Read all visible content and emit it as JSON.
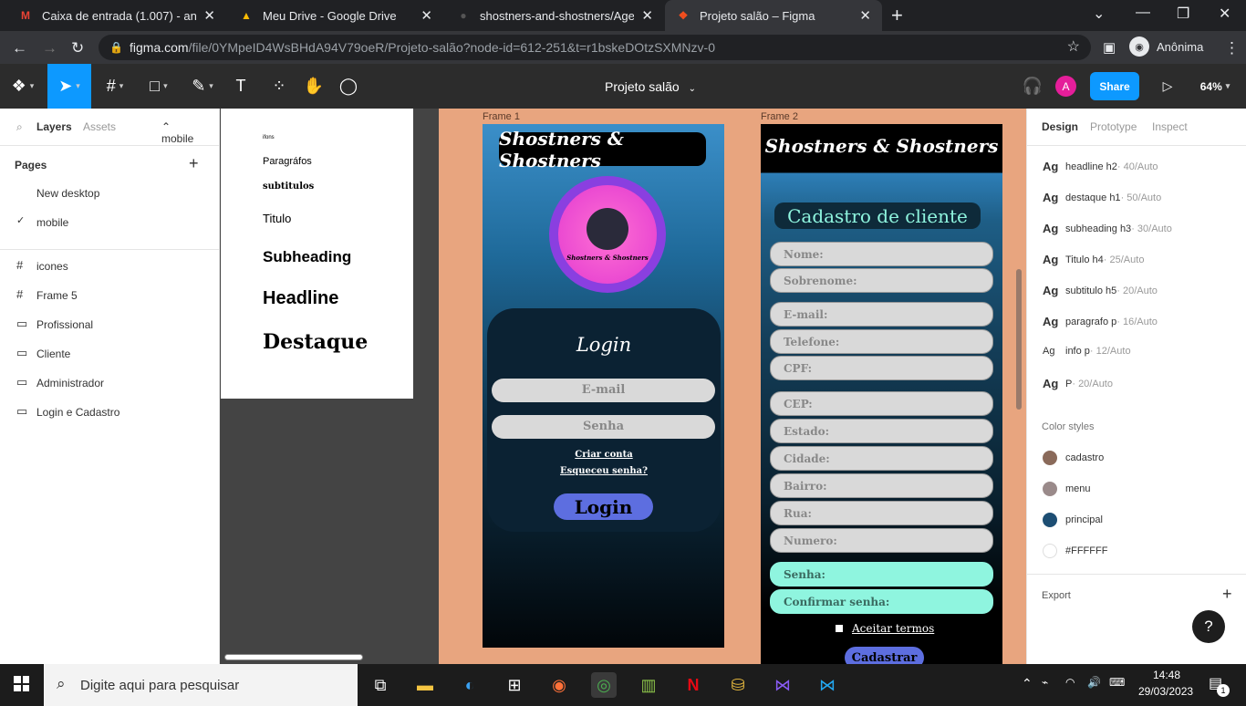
{
  "browser": {
    "tabs": [
      {
        "label": "Caixa de entrada (1.007) - antoni",
        "icon": "gmail-icon"
      },
      {
        "label": "Meu Drive - Google Drive",
        "icon": "drive-icon"
      },
      {
        "label": "shostners-and-shostners/Agenda",
        "icon": "github-icon"
      },
      {
        "label": "Projeto salão – Figma",
        "icon": "figma-icon"
      }
    ],
    "url_domain": "figma.com",
    "url_path": "/file/0YMpeID4WsBHdA94V79oeR/Projeto-salão?node-id=612-251&t=r1bskeDOtzSXMNzv-0",
    "profile": "Anônima"
  },
  "figma": {
    "file_title": "Projeto salão",
    "share_label": "Share",
    "avatar_letter": "A",
    "zoom": "64%",
    "left_tabs": {
      "layers": "Layers",
      "assets": "Assets",
      "page": "mobile"
    },
    "pages_title": "Pages",
    "pages": [
      "New desktop",
      "mobile"
    ],
    "layers": [
      {
        "name": "icones",
        "icon": "#"
      },
      {
        "name": "Frame 5",
        "icon": "#"
      },
      {
        "name": "Profissional",
        "icon": "▭"
      },
      {
        "name": "Cliente",
        "icon": "▭"
      },
      {
        "name": "Administrador",
        "icon": "▭"
      },
      {
        "name": "Login e Cadastro",
        "icon": "▭"
      }
    ],
    "right_tabs": [
      "Design",
      "Prototype",
      "Inspect"
    ],
    "text_styles": [
      {
        "name": "headline h2",
        "meta": " · 40/Auto"
      },
      {
        "name": "destaque h1",
        "meta": " · 50/Auto"
      },
      {
        "name": "subheading h3",
        "meta": " · 30/Auto"
      },
      {
        "name": "Titulo h4",
        "meta": " · 25/Auto"
      },
      {
        "name": "subtitulo h5",
        "meta": " · 20/Auto"
      },
      {
        "name": "paragrafo p",
        "meta": " · 16/Auto"
      },
      {
        "name": "info p",
        "meta": " · 12/Auto"
      },
      {
        "name": "P",
        "meta": " · 20/Auto"
      }
    ],
    "color_styles_title": "Color styles",
    "color_styles": [
      {
        "name": "cadastro",
        "color": "#8a6a5a"
      },
      {
        "name": "menu",
        "color": "#9a8a8a"
      },
      {
        "name": "principal",
        "color": "#1d4e73"
      },
      {
        "name": "#FFFFFF",
        "color": "#ffffff"
      }
    ],
    "export_label": "Export",
    "help": "?"
  },
  "canvas": {
    "typography": [
      "ifons",
      "Paragráfos",
      "subtitulos",
      "Titulo",
      "Subheading",
      "Headline",
      "Destaque"
    ],
    "frame1": {
      "label": "Frame 1",
      "title": "Shostners & Shostners",
      "logo_text": "Shostners & Shostners",
      "login_title": "Login",
      "email": "E-mail",
      "senha": "Senha",
      "criar": "Criar conta",
      "esqueceu": "Esqueceu senha?",
      "button": "Login"
    },
    "frame2": {
      "label": "Frame 2",
      "title": "Shostners & Shostners",
      "heading": "Cadastro de cliente",
      "fields": [
        "Nome:",
        "Sobrenome:",
        "E-mail:",
        "Telefone:",
        "CPF:",
        "CEP:",
        "Estado:",
        "Cidade:",
        "Bairro:",
        "Rua:",
        "Numero:"
      ],
      "pass_fields": [
        "Senha:",
        "Confirmar senha:"
      ],
      "terms": "Aceitar termos",
      "button": "Cadastrar"
    }
  },
  "taskbar": {
    "search": "Digite aqui para pesquisar",
    "time": "14:48",
    "date": "29/03/2023",
    "notif": "1"
  }
}
